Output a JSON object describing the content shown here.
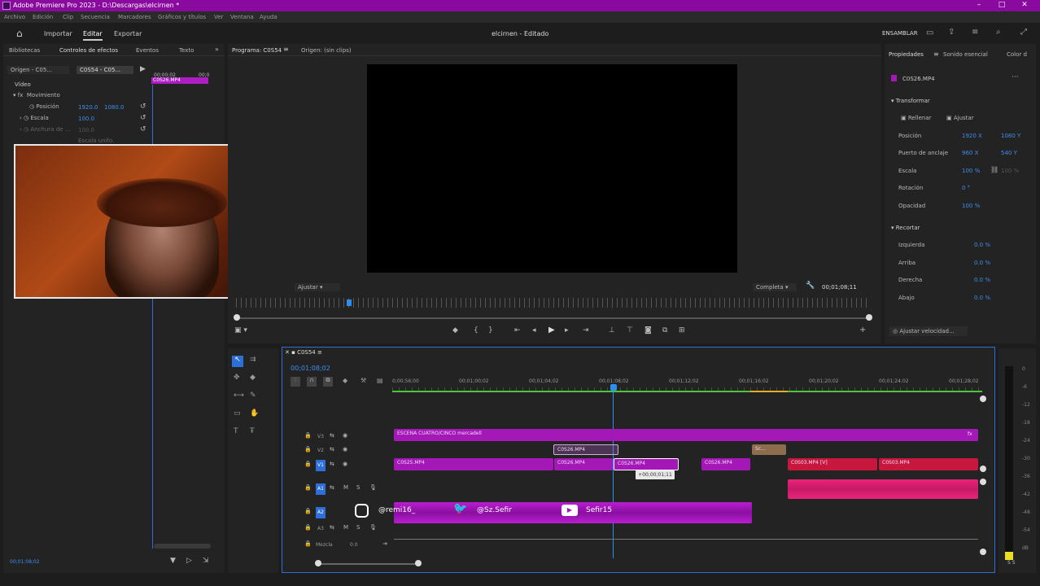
{
  "window": {
    "title": "Adobe Premiere Pro 2023 - D:\\Descargas\\elcirnen *"
  },
  "menu": [
    "Archivo",
    "Edición",
    "Clip",
    "Secuencia",
    "Marcadores",
    "Gráficos y títulos",
    "Ver",
    "Ventana",
    "Ayuda"
  ],
  "nav": {
    "importar": "Importar",
    "editar": "Editar",
    "exportar": "Exportar",
    "project": "elcirnen - Editado",
    "workspace": "ENSAMBLAR"
  },
  "left_tabs": [
    "Bibliotecas",
    "Controles de efectos",
    "Eventos",
    "Texto"
  ],
  "source": {
    "origin1": "Origen - C05...",
    "origin2": "C0S54 - C05...",
    "clip": "C0S26.MP4",
    "time1": "00;00;02",
    "time2": "00;0"
  },
  "effects": {
    "video": "Vídeo",
    "fx": "fx",
    "movimiento": "Movimiento",
    "posicion": "Posición",
    "pos_x": "1920.0",
    "pos_y": "1080.0",
    "escala": "Escala",
    "escala_val": "100.0",
    "anchura": "Anchura de ...",
    "anchura_val": "100.0",
    "escala_unif": "Escala unifo.",
    "bottom_time": "00;01;08;02"
  },
  "program": {
    "tab": "Programa: C0S54",
    "source_tab": "Origen: (sin clips)",
    "fit": "Ajustar",
    "quality": "Completa",
    "timecode": "00;01;08;11"
  },
  "properties": {
    "tabs": [
      "Propiedades",
      "Sonido esencial",
      "Color d"
    ],
    "clip": "C0S26.MP4",
    "transformar": "Transformar",
    "rellenar": "Rellenar",
    "ajustar": "Ajustar",
    "posicion": "Posición",
    "pos_x": "1920 X",
    "pos_y": "1080 Y",
    "punto": "Puerto de anclaje",
    "pt_x": "960 X",
    "pt_y": "540 Y",
    "escala": "Escala",
    "escala_val": "100 %",
    "escala_val2": "100 %",
    "rotacion": "Rotación",
    "rot_val": "0 °",
    "opacidad": "Opacidad",
    "op_val": "100 %",
    "recortar": "Recortar",
    "izq": "Izquierda",
    "izq_val": "0.0 %",
    "arriba": "Arriba",
    "arr_val": "0.0 %",
    "derecha": "Derecha",
    "der_val": "0.0 %",
    "abajo": "Abajo",
    "aba_val": "0.0 %",
    "speed": "Ajustar velocidad..."
  },
  "timeline": {
    "seq": "C0S54",
    "timecode": "00;01;08;02",
    "ruler": [
      "0;00;56;00",
      "00;01;00;02",
      "00;01;04;02",
      "00;01;08;02",
      "00;01;12;02",
      "00;01;16;02",
      "00;01;20;02",
      "00;01;24;02",
      "00;01;28;02"
    ],
    "tracks": {
      "v3": "V3",
      "v2": "V2",
      "v1": "V1",
      "a1": "A1",
      "a2": "A2",
      "a3": "A3",
      "mezcla": "Mezcla",
      "mezcla_val": "0.0"
    },
    "clips": {
      "escena": "ESCENA CUATRO/CINCO mercadell",
      "v1a": "C0S25.MP4",
      "v2a": "C0S26.MP4",
      "v1b": "C0S26.MP4",
      "v1c": "C0S26.MP4",
      "v1d": "C0S26.MP4",
      "sc": "Sc...",
      "v1e": "C0S03.MP4 [V]",
      "v1f": "C0S03.MP4",
      "tooltip": "+00;00;01;11",
      "fx": "fx"
    },
    "social": {
      "instagram": "@remi16_",
      "twitter": "@Sz.Sefir",
      "youtube": "Sefir15"
    }
  },
  "meter_labels": [
    "0",
    "-6",
    "-12",
    "-18",
    "-24",
    "-30",
    "-36",
    "-42",
    "-48",
    "-54",
    "dB"
  ],
  "meter_bottom": "S S"
}
